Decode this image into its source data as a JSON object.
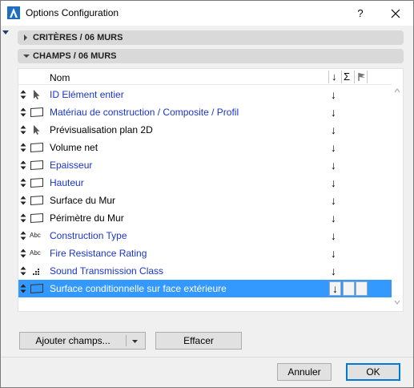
{
  "window": {
    "title": "Options Configuration",
    "help_label": "?",
    "close_label": "×"
  },
  "sections": {
    "criteres": {
      "label": "CRITÈRES / 06 MURS",
      "expanded": false
    },
    "champs": {
      "label": "CHAMPS / 06 MURS",
      "expanded": true
    }
  },
  "table": {
    "header": {
      "name_label": "Nom",
      "sort_icon": "arrow-down-icon",
      "sum_label": "Σ",
      "flag_icon": "flag-icon"
    },
    "rows": [
      {
        "label": "ID Elément entier",
        "icon": "cursor-icon",
        "color": "blue"
      },
      {
        "label": "Matériau de construction / Composite / Profil",
        "icon": "parallelogram-icon",
        "color": "blue"
      },
      {
        "label": "Prévisualisation plan 2D",
        "icon": "cursor-icon",
        "color": "black"
      },
      {
        "label": "Volume net",
        "icon": "parallelogram-icon",
        "color": "black"
      },
      {
        "label": "Epaisseur",
        "icon": "parallelogram-icon",
        "color": "blue"
      },
      {
        "label": "Hauteur",
        "icon": "parallelogram-icon",
        "color": "blue"
      },
      {
        "label": "Surface du Mur",
        "icon": "parallelogram-icon",
        "color": "black"
      },
      {
        "label": "Périmètre du Mur",
        "icon": "parallelogram-icon",
        "color": "black"
      },
      {
        "label": "Construction Type",
        "icon": "abc",
        "abc_text": "Abc",
        "color": "blue"
      },
      {
        "label": "Fire Resistance Rating",
        "icon": "abc",
        "abc_text": "Abc",
        "color": "blue"
      },
      {
        "label": "Sound Transmission Class",
        "icon": "dots-icon",
        "color": "blue"
      },
      {
        "label": "Surface conditionnelle sur face extérieure",
        "icon": "parallelogram-icon",
        "color": "white",
        "selected": true
      }
    ]
  },
  "buttons": {
    "add_fields": "Ajouter champs...",
    "clear": "Effacer",
    "cancel": "Annuler",
    "ok": "OK"
  },
  "colors": {
    "link_blue": "#1a35c8",
    "selection": "#3399ff",
    "section_bg": "#d9d9d9",
    "dialog_bg": "#f0f0f0"
  }
}
